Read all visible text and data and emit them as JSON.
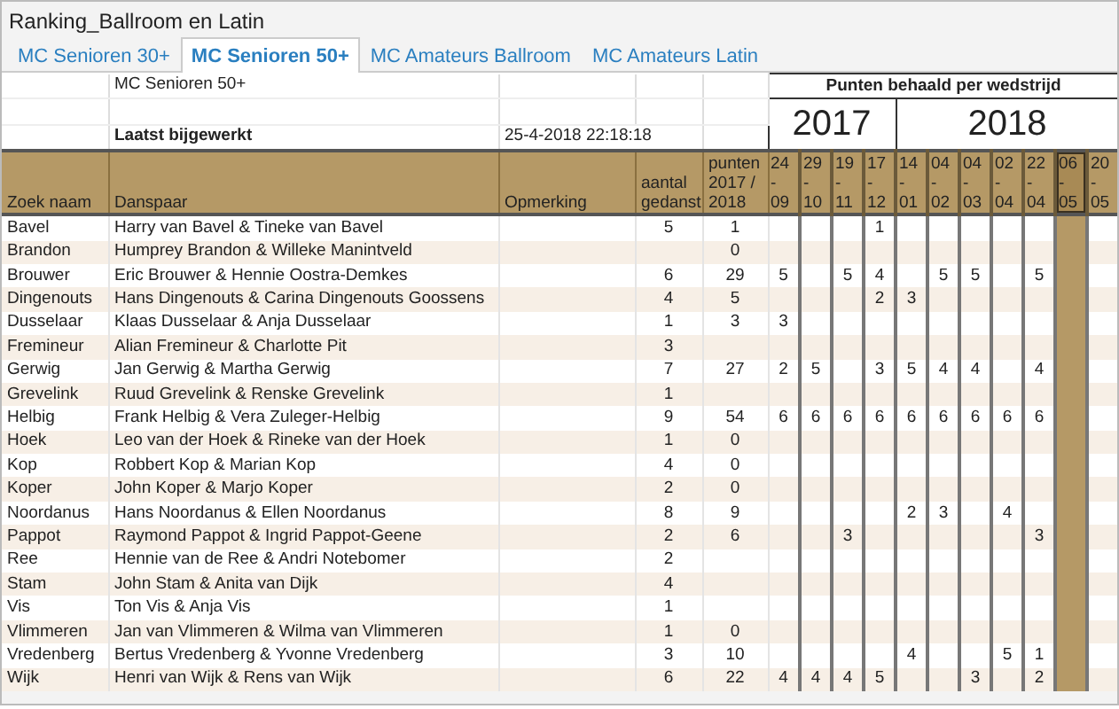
{
  "window": {
    "title": "Ranking_Ballroom en Latin"
  },
  "tabs": [
    {
      "label": "MC Senioren 30+",
      "selected": false
    },
    {
      "label": "MC Senioren 50+",
      "selected": true
    },
    {
      "label": "MC Amateurs Ballroom",
      "selected": false
    },
    {
      "label": "MC Amateurs Latin",
      "selected": false
    }
  ],
  "sheet": {
    "subtitle": "MC Senioren 50+",
    "updated_label": "Laatst bijgewerkt",
    "updated_value": "25-4-2018 22:18:18",
    "points_heading": "Punten behaald per wedstrijd",
    "columns": [
      "Zoek naam",
      "Danspaar",
      "Opmerking",
      "aantal gedanst",
      "punten 2017 / 2018"
    ],
    "years": [
      {
        "label": "2017",
        "dates": [
          {
            "label": "24 - 09",
            "highlighted": false
          },
          {
            "label": "29 - 10",
            "highlighted": false
          },
          {
            "label": "19 - 11",
            "highlighted": false
          },
          {
            "label": "17 - 12",
            "highlighted": false
          }
        ]
      },
      {
        "label": "2018",
        "dates": [
          {
            "label": "14 - 01",
            "highlighted": false
          },
          {
            "label": "04 - 02",
            "highlighted": false
          },
          {
            "label": "04 - 03",
            "highlighted": false
          },
          {
            "label": "02 - 04",
            "highlighted": false
          },
          {
            "label": "22 - 04",
            "highlighted": false
          },
          {
            "label": "06 - 05",
            "highlighted": true
          },
          {
            "label": "20 - 05",
            "highlighted": false
          }
        ]
      }
    ],
    "rows": [
      {
        "name": "Bavel",
        "pair": "Harry van Bavel & Tineke van Bavel",
        "count": "5",
        "points": "1",
        "scores": [
          {
            "kind": "blank"
          },
          {
            "kind": "blank"
          },
          {
            "kind": "blank"
          },
          {
            "kind": "score",
            "value": "1"
          },
          {
            "kind": "blank"
          },
          {
            "kind": "blank"
          },
          {
            "kind": "blank"
          },
          {
            "kind": "blank"
          },
          {
            "kind": "blank"
          },
          {
            "kind": "blank"
          },
          {
            "kind": "blank"
          }
        ]
      },
      {
        "name": "Brandon",
        "pair": "Humprey Brandon & Willeke Manintveld",
        "points": "0",
        "scores": [
          {
            "kind": "blank"
          },
          {
            "kind": "blank"
          },
          {
            "kind": "blank"
          },
          {
            "kind": "blank"
          },
          {
            "kind": "blank"
          },
          {
            "kind": "blank"
          },
          {
            "kind": "blank"
          },
          {
            "kind": "blank"
          },
          {
            "kind": "blank"
          },
          {
            "kind": "blank"
          },
          {
            "kind": "blank"
          }
        ]
      },
      {
        "name": "Brouwer",
        "pair": "Eric Brouwer & Hennie Oostra-Demkes",
        "count": "6",
        "points": "29",
        "scores": [
          {
            "kind": "score",
            "value": "5"
          },
          {
            "kind": "blank"
          },
          {
            "kind": "score",
            "value": "5"
          },
          {
            "kind": "score",
            "value": "4"
          },
          {
            "kind": "blank"
          },
          {
            "kind": "score",
            "value": "5"
          },
          {
            "kind": "score",
            "value": "5"
          },
          {
            "kind": "blank"
          },
          {
            "kind": "score",
            "value": "5"
          },
          {
            "kind": "blank"
          },
          {
            "kind": "blank"
          }
        ]
      },
      {
        "name": "Dingenouts",
        "pair": "Hans Dingenouts & Carina Dingenouts Goossens",
        "count": "4",
        "points": "5",
        "scores": [
          {
            "kind": "blank"
          },
          {
            "kind": "blank"
          },
          {
            "kind": "blank"
          },
          {
            "kind": "score",
            "value": "2"
          },
          {
            "kind": "score",
            "value": "3"
          },
          {
            "kind": "blank"
          },
          {
            "kind": "blank"
          },
          {
            "kind": "blank"
          },
          {
            "kind": "blank"
          },
          {
            "kind": "blank"
          },
          {
            "kind": "blank"
          }
        ]
      },
      {
        "name": "Dusselaar",
        "pair": "Klaas Dusselaar & Anja Dusselaar",
        "count": "1",
        "points": "3",
        "scores": [
          {
            "kind": "score",
            "value": "3"
          },
          {
            "kind": "blank"
          },
          {
            "kind": "blank"
          },
          {
            "kind": "blank"
          },
          {
            "kind": "blank"
          },
          {
            "kind": "blank"
          },
          {
            "kind": "blank"
          },
          {
            "kind": "blank"
          },
          {
            "kind": "blank"
          },
          {
            "kind": "blank"
          },
          {
            "kind": "blank"
          }
        ]
      },
      {
        "name": "Fremineur",
        "pair": "Alian Fremineur & Charlotte Pit",
        "count": "3",
        "scores": [
          {
            "kind": "blank"
          },
          {
            "kind": "blank"
          },
          {
            "kind": "blank"
          },
          {
            "kind": "blank"
          },
          {
            "kind": "blank"
          },
          {
            "kind": "blank"
          },
          {
            "kind": "blank"
          },
          {
            "kind": "blank"
          },
          {
            "kind": "blank"
          },
          {
            "kind": "blank"
          },
          {
            "kind": "blank"
          }
        ]
      },
      {
        "name": "Gerwig",
        "pair": "Jan Gerwig & Martha Gerwig",
        "count": "7",
        "points": "27",
        "scores": [
          {
            "kind": "score",
            "value": "2"
          },
          {
            "kind": "score",
            "value": "5"
          },
          {
            "kind": "blank"
          },
          {
            "kind": "score",
            "value": "3"
          },
          {
            "kind": "score",
            "value": "5"
          },
          {
            "kind": "score",
            "value": "4"
          },
          {
            "kind": "score",
            "value": "4"
          },
          {
            "kind": "blank"
          },
          {
            "kind": "score",
            "value": "4"
          },
          {
            "kind": "blank"
          },
          {
            "kind": "blank"
          }
        ]
      },
      {
        "name": "Grevelink",
        "pair": "Ruud Grevelink & Renske Grevelink",
        "count": "1",
        "scores": [
          {
            "kind": "blank"
          },
          {
            "kind": "blank"
          },
          {
            "kind": "blank"
          },
          {
            "kind": "blank"
          },
          {
            "kind": "blank"
          },
          {
            "kind": "blank"
          },
          {
            "kind": "blank"
          },
          {
            "kind": "blank"
          },
          {
            "kind": "blank"
          },
          {
            "kind": "blank"
          },
          {
            "kind": "blank"
          }
        ]
      },
      {
        "name": "Helbig",
        "pair": "Frank Helbig & Vera Zuleger-Helbig",
        "count": "9",
        "points": "54",
        "scores": [
          {
            "kind": "score",
            "value": "6"
          },
          {
            "kind": "score",
            "value": "6"
          },
          {
            "kind": "score",
            "value": "6"
          },
          {
            "kind": "score",
            "value": "6"
          },
          {
            "kind": "score",
            "value": "6"
          },
          {
            "kind": "score",
            "value": "6"
          },
          {
            "kind": "score",
            "value": "6"
          },
          {
            "kind": "score",
            "value": "6"
          },
          {
            "kind": "score",
            "value": "6"
          },
          {
            "kind": "blank"
          },
          {
            "kind": "blank"
          }
        ]
      },
      {
        "name": "Hoek",
        "pair": "Leo van der Hoek & Rineke van der Hoek",
        "count": "1",
        "points": "0",
        "scores": [
          {
            "kind": "blank"
          },
          {
            "kind": "blank"
          },
          {
            "kind": "blank"
          },
          {
            "kind": "blank"
          },
          {
            "kind": "blank"
          },
          {
            "kind": "blank"
          },
          {
            "kind": "blank"
          },
          {
            "kind": "blank"
          },
          {
            "kind": "blank"
          },
          {
            "kind": "blank"
          },
          {
            "kind": "blank"
          }
        ]
      },
      {
        "name": "Kop",
        "pair": "Robbert Kop & Marian Kop",
        "count": "4",
        "points": "0",
        "scores": [
          {
            "kind": "blank"
          },
          {
            "kind": "blank"
          },
          {
            "kind": "blank"
          },
          {
            "kind": "blank"
          },
          {
            "kind": "blank"
          },
          {
            "kind": "blank"
          },
          {
            "kind": "blank"
          },
          {
            "kind": "blank"
          },
          {
            "kind": "blank"
          },
          {
            "kind": "blank"
          },
          {
            "kind": "blank"
          }
        ]
      },
      {
        "name": "Koper",
        "pair": "John Koper & Marjo Koper",
        "count": "2",
        "points": "0",
        "scores": [
          {
            "kind": "blank"
          },
          {
            "kind": "blank"
          },
          {
            "kind": "blank"
          },
          {
            "kind": "blank"
          },
          {
            "kind": "blank"
          },
          {
            "kind": "blank"
          },
          {
            "kind": "blank"
          },
          {
            "kind": "blank"
          },
          {
            "kind": "blank"
          },
          {
            "kind": "blank"
          },
          {
            "kind": "blank"
          }
        ]
      },
      {
        "name": "Noordanus",
        "pair": "Hans Noordanus & Ellen Noordanus",
        "count": "8",
        "points": "9",
        "scores": [
          {
            "kind": "blank"
          },
          {
            "kind": "blank"
          },
          {
            "kind": "blank"
          },
          {
            "kind": "blank"
          },
          {
            "kind": "score",
            "value": "2"
          },
          {
            "kind": "score",
            "value": "3"
          },
          {
            "kind": "blank"
          },
          {
            "kind": "score",
            "value": "4"
          },
          {
            "kind": "blank"
          },
          {
            "kind": "blank"
          },
          {
            "kind": "blank"
          }
        ]
      },
      {
        "name": "Pappot",
        "pair": "Raymond Pappot & Ingrid Pappot-Geene",
        "count": "2",
        "points": "6",
        "scores": [
          {
            "kind": "blank"
          },
          {
            "kind": "blank"
          },
          {
            "kind": "score",
            "value": "3"
          },
          {
            "kind": "blank"
          },
          {
            "kind": "blank"
          },
          {
            "kind": "blank"
          },
          {
            "kind": "blank"
          },
          {
            "kind": "blank"
          },
          {
            "kind": "score",
            "value": "3"
          },
          {
            "kind": "blank"
          },
          {
            "kind": "blank"
          }
        ]
      },
      {
        "name": "Ree",
        "pair": "Hennie van de Ree & Andri Notebomer",
        "count": "2",
        "scores": [
          {
            "kind": "blank"
          },
          {
            "kind": "blank"
          },
          {
            "kind": "blank"
          },
          {
            "kind": "blank"
          },
          {
            "kind": "blank"
          },
          {
            "kind": "blank"
          },
          {
            "kind": "blank"
          },
          {
            "kind": "blank"
          },
          {
            "kind": "blank"
          },
          {
            "kind": "blank"
          },
          {
            "kind": "blank"
          }
        ]
      },
      {
        "name": "Stam",
        "pair": "John Stam & Anita van Dijk",
        "count": "4",
        "scores": [
          {
            "kind": "blank"
          },
          {
            "kind": "blank"
          },
          {
            "kind": "blank"
          },
          {
            "kind": "blank"
          },
          {
            "kind": "blank"
          },
          {
            "kind": "blank"
          },
          {
            "kind": "blank"
          },
          {
            "kind": "blank"
          },
          {
            "kind": "blank"
          },
          {
            "kind": "blank"
          },
          {
            "kind": "blank"
          }
        ]
      },
      {
        "name": "Vis",
        "pair": "Ton Vis & Anja Vis",
        "count": "1",
        "scores": [
          {
            "kind": "blank"
          },
          {
            "kind": "blank"
          },
          {
            "kind": "blank"
          },
          {
            "kind": "blank"
          },
          {
            "kind": "blank"
          },
          {
            "kind": "blank"
          },
          {
            "kind": "blank"
          },
          {
            "kind": "blank"
          },
          {
            "kind": "blank"
          },
          {
            "kind": "blank"
          },
          {
            "kind": "blank"
          }
        ]
      },
      {
        "name": "Vlimmeren",
        "pair": "Jan van Vlimmeren & Wilma van Vlimmeren",
        "count": "1",
        "points": "0",
        "scores": [
          {
            "kind": "blank"
          },
          {
            "kind": "blank"
          },
          {
            "kind": "blank"
          },
          {
            "kind": "blank"
          },
          {
            "kind": "blank"
          },
          {
            "kind": "blank"
          },
          {
            "kind": "blank"
          },
          {
            "kind": "blank"
          },
          {
            "kind": "blank"
          },
          {
            "kind": "blank"
          },
          {
            "kind": "blank"
          }
        ]
      },
      {
        "name": "Vredenberg",
        "pair": "Bertus Vredenberg & Yvonne Vredenberg",
        "count": "3",
        "points": "10",
        "scores": [
          {
            "kind": "blank"
          },
          {
            "kind": "blank"
          },
          {
            "kind": "blank"
          },
          {
            "kind": "blank"
          },
          {
            "kind": "score",
            "value": "4"
          },
          {
            "kind": "blank"
          },
          {
            "kind": "blank"
          },
          {
            "kind": "score",
            "value": "5"
          },
          {
            "kind": "score",
            "value": "1"
          },
          {
            "kind": "blank"
          },
          {
            "kind": "blank"
          }
        ]
      },
      {
        "name": "Wijk",
        "pair": "Henri van Wijk & Rens van Wijk",
        "count": "6",
        "points": "22",
        "scores": [
          {
            "kind": "score",
            "value": "4"
          },
          {
            "kind": "score",
            "value": "4"
          },
          {
            "kind": "score",
            "value": "4"
          },
          {
            "kind": "score",
            "value": "5"
          },
          {
            "kind": "blank"
          },
          {
            "kind": "blank"
          },
          {
            "kind": "score",
            "value": "3"
          },
          {
            "kind": "blank"
          },
          {
            "kind": "score",
            "value": "2"
          },
          {
            "kind": "blank"
          },
          {
            "kind": "blank"
          }
        ]
      }
    ]
  }
}
